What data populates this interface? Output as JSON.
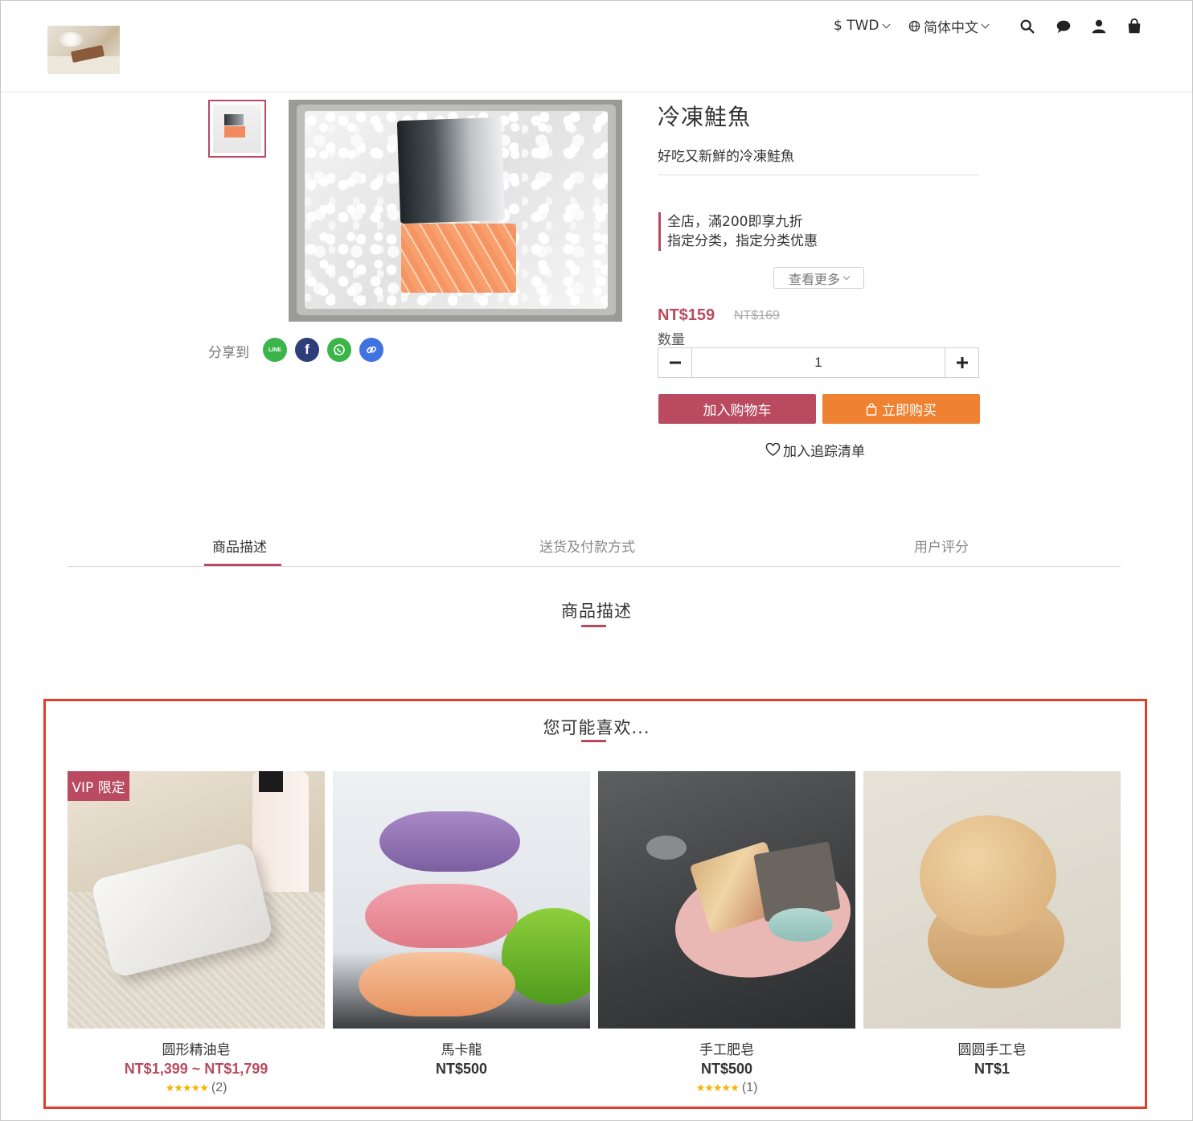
{
  "header": {
    "currency": "$ TWD",
    "language": "简体中文",
    "icons": [
      "search-icon",
      "chat-icon",
      "user-icon",
      "cart-icon"
    ]
  },
  "product": {
    "title": "冷凍鮭魚",
    "subtitle": "好吃又新鮮的冷凍鮭魚",
    "promotions": [
      "全店，滿200即享九折",
      "指定分类，指定分类优惠"
    ],
    "see_more": "查看更多",
    "price": "NT$159",
    "original_price": "NT$169",
    "quantity_label": "数量",
    "quantity": "1",
    "add_to_cart": "加入购物车",
    "buy_now": "立即购买",
    "wishlist": "加入追踪清单"
  },
  "share": {
    "label": "分享到",
    "buttons": [
      "line-icon",
      "facebook-icon",
      "whatsapp-icon",
      "link-icon"
    ],
    "line_text": "LINE",
    "facebook_text": "f"
  },
  "tabs": [
    {
      "label": "商品描述",
      "active": true
    },
    {
      "label": "送货及付款方式",
      "active": false
    },
    {
      "label": "用户评分",
      "active": false
    }
  ],
  "description_title": "商品描述",
  "recommendations": {
    "title": "您可能喜欢...",
    "items": [
      {
        "name": "圆形精油皂",
        "price": "NT$1,399 ~ NT$1,799",
        "badge": "VIP 限定",
        "stars": "★★★★★",
        "reviews": "(2)"
      },
      {
        "name": "馬卡龍",
        "price": "NT$500"
      },
      {
        "name": "手工肥皂",
        "price": "NT$500",
        "stars": "★★★★★",
        "reviews": "(1)"
      },
      {
        "name": "圆圆手工皂",
        "price": "NT$1"
      }
    ]
  },
  "colors": {
    "accent": "#b94a5f",
    "buy_now": "#ef8132",
    "highlight_border": "#e0402a",
    "star": "#f5b400"
  }
}
